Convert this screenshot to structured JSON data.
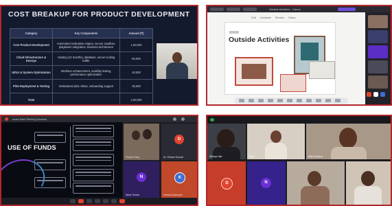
{
  "cost_slide": {
    "title": "COST BREAKUP FOR PRODUCT DEVELOPMENT",
    "headers": [
      "Category",
      "Key Components",
      "Amount (₹)"
    ],
    "rows": [
      [
        "Core Product Development",
        "Automated evaluation engine, secure sandbox, plagiarism integration, backend architecture",
        "1,50,000"
      ],
      [
        "Cloud Infrastructure & DevOps",
        "Hosting (12 months), database, server scaling buffer",
        "60,000"
      ],
      [
        "UI/UX & System Optimization",
        "Interface enhancement, usability testing, performance optimization",
        "40,000"
      ],
      [
        "Pilot Deployment & Testing",
        "Institutional pilot rollout, onboarding support",
        "30,000"
      ],
      [
        "Total",
        "",
        "4,00,000"
      ]
    ]
  },
  "canvas_board": {
    "tab_text": "Outside Activities · Canva",
    "toolbar": [
      "Edit",
      "Annotate",
      "Review",
      "Share"
    ],
    "title": "Outside Activities"
  },
  "funds_slide": {
    "window_title": "Anna Saini Pitching Session",
    "title": "USE OF FUNDS",
    "participants": [
      {
        "name": "Shaina Garg",
        "initial": "",
        "color": "#6a5a4e"
      },
      {
        "name": "Dr. Shivani Kumari",
        "initial": "D",
        "color": "#e0432f"
      },
      {
        "name": "Neha Trivedi",
        "initial": "N",
        "color": "#6b2fd6"
      },
      {
        "name": "Kanika Mukherjee",
        "initial": "K",
        "color": "#3b6fd1"
      }
    ]
  },
  "gallery": {
    "participants": [
      {
        "name": "Shreya Jain",
        "initial": ""
      },
      {
        "name": "Riya",
        "initial": ""
      },
      {
        "name": "Nidhi Sharma",
        "initial": ""
      },
      {
        "name": "",
        "initial": "D"
      },
      {
        "name": "",
        "initial": "N"
      },
      {
        "name": "",
        "initial": ""
      },
      {
        "name": "",
        "initial": ""
      }
    ]
  },
  "colors": {
    "frame_border": "#b3262b",
    "slide_navy": "#141a2d",
    "avatar_orange": "#e0432f",
    "avatar_purple": "#6b2fd6"
  }
}
